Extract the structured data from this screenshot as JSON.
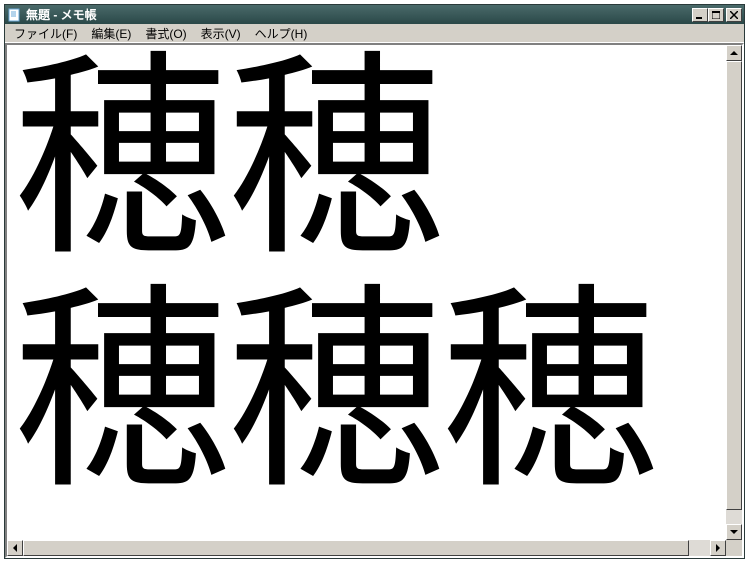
{
  "window": {
    "title": "無題 - メモ帳"
  },
  "menu": {
    "file": "ファイル(F)",
    "edit": "編集(E)",
    "format": "書式(O)",
    "view": "表示(V)",
    "help": "ヘルプ(H)"
  },
  "editor": {
    "content": "穂穂\n穂穂穂"
  }
}
